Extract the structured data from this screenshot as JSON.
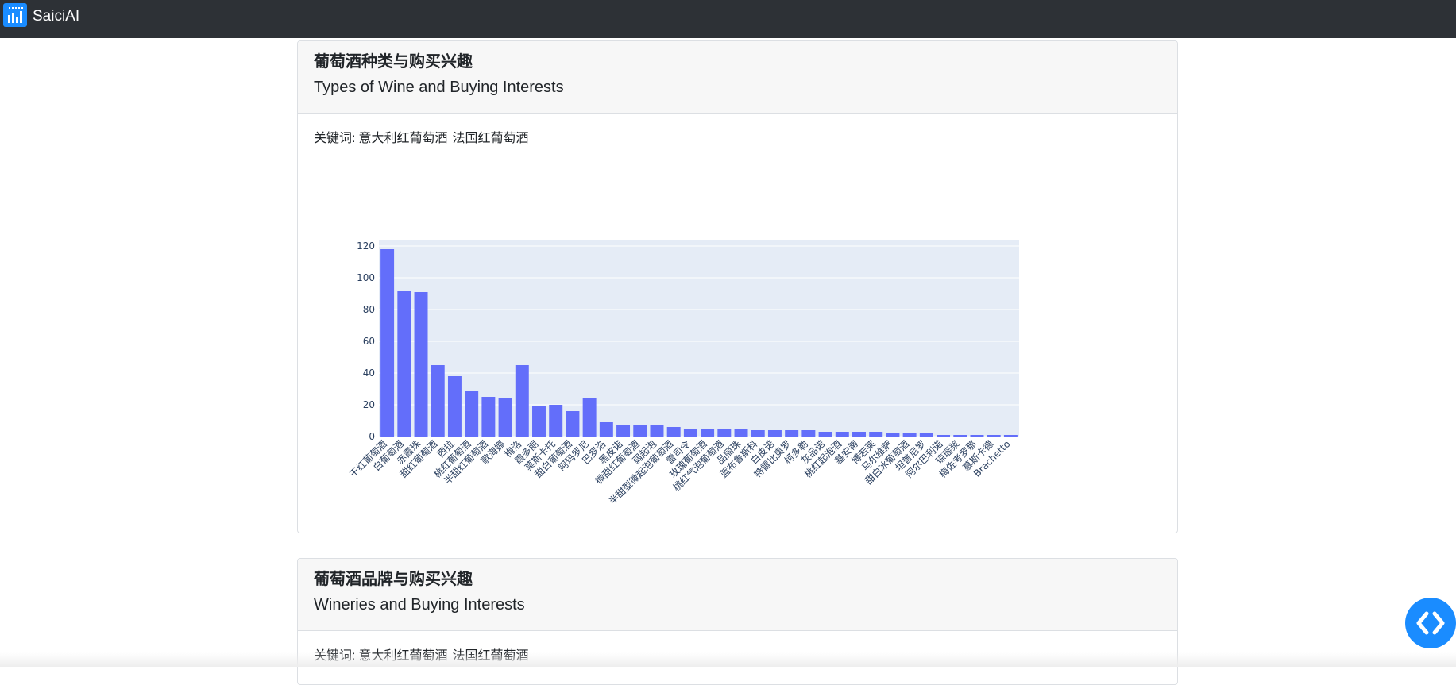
{
  "app": {
    "name": "SaiciAI",
    "logo_icon": "bar-chart-logo-icon",
    "fab_icon": "code-icon",
    "accent_color": "#1a8cff",
    "navbar_color": "#2d3136"
  },
  "sections": [
    {
      "title_zh": "葡萄酒种类与购买兴趣",
      "title_en": "Types of Wine and Buying Interests",
      "keywords_label": "关键词:",
      "keywords": [
        "意大利红葡萄酒",
        "法国红葡萄酒"
      ]
    },
    {
      "title_zh": "葡萄酒品牌与购买兴趣",
      "title_en": "Wineries and Buying Interests",
      "keywords_label": "关键词:",
      "keywords": [
        "意大利红葡萄酒",
        "法国红葡萄酒"
      ]
    }
  ],
  "chart_data": {
    "type": "bar",
    "categories": [
      "干红葡萄酒",
      "白葡萄酒",
      "赤霞珠",
      "甜红葡萄酒",
      "西拉",
      "桃红葡萄酒",
      "半甜红葡萄酒",
      "歌海娜",
      "梅洛",
      "霞多丽",
      "莫斯卡托",
      "甜白葡萄酒",
      "阿玛罗尼",
      "巴罗洛",
      "黑皮诺",
      "微甜红葡萄酒",
      "弱起泡",
      "半甜型微起泡葡萄酒",
      "雷司令",
      "玫瑰葡萄酒",
      "桃红气泡葡萄酒",
      "品丽珠",
      "蓝布鲁斯科",
      "白皮诺",
      "特雷比奥罗",
      "柯多勒",
      "灰品诺",
      "桃红起泡酒",
      "基安蒂",
      "博若莱",
      "马尔维萨",
      "甜白冰葡萄酒",
      "坦普尼罗",
      "阿尔巴利诺",
      "琼瑶浆",
      "梅佐考罗那",
      "慕斯卡德",
      "Brachetto"
    ],
    "values": [
      118,
      92,
      91,
      45,
      38,
      29,
      25,
      24,
      45,
      19,
      20,
      16,
      24,
      9,
      7,
      7,
      7,
      6,
      5,
      5,
      5,
      5,
      4,
      4,
      4,
      4,
      3,
      3,
      3,
      3,
      2,
      2,
      2,
      1,
      1,
      1,
      1,
      1
    ],
    "yticks": [
      0,
      20,
      40,
      60,
      80,
      100,
      120
    ],
    "ylim": [
      0,
      124
    ],
    "bar_color": "#636efa",
    "plot_bg": "#e5ecf6",
    "grid": true,
    "title": "",
    "xlabel": "",
    "ylabel": ""
  }
}
